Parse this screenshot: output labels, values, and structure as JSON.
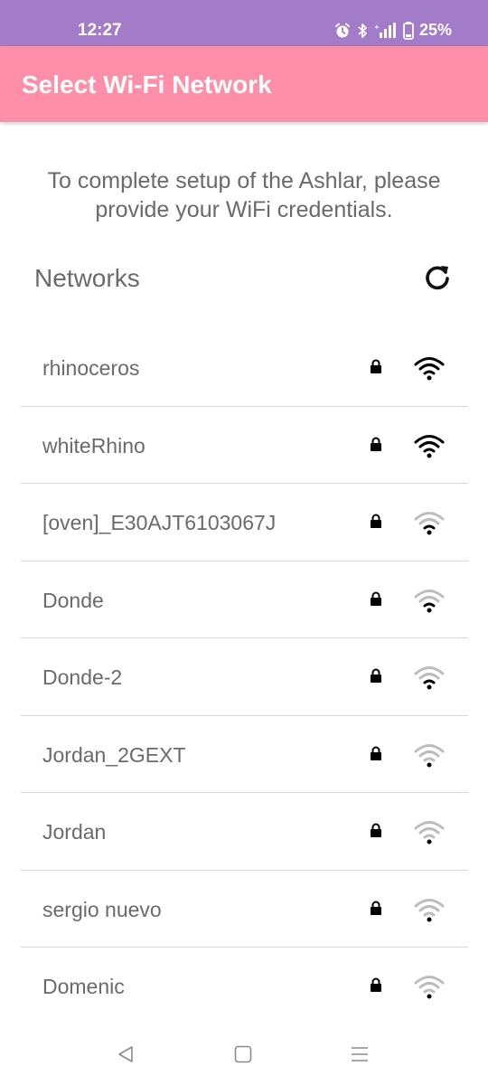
{
  "status_bar": {
    "time": "12:27",
    "battery": "25%",
    "icons": [
      "alarm-icon",
      "bluetooth-icon",
      "signal-icon",
      "battery-icon"
    ],
    "background": "#a27bc9"
  },
  "app_bar": {
    "title": "Select Wi-Fi Network",
    "background": "#ff8fa8"
  },
  "intro": {
    "line1": "To complete setup of the Ashlar, please",
    "line2": "provide your WiFi credentials."
  },
  "networks": {
    "heading": "Networks",
    "refresh_icon": "refresh-icon",
    "items": [
      {
        "ssid": "rhinoceros",
        "secured": true,
        "signal_bars": 3
      },
      {
        "ssid": "whiteRhino",
        "secured": true,
        "signal_bars": 3
      },
      {
        "ssid": "[oven]_E30AJT6103067J",
        "secured": true,
        "signal_bars": 1
      },
      {
        "ssid": "Donde",
        "secured": true,
        "signal_bars": 1
      },
      {
        "ssid": "Donde-2",
        "secured": true,
        "signal_bars": 1
      },
      {
        "ssid": "Jordan_2GEXT",
        "secured": true,
        "signal_bars": 0
      },
      {
        "ssid": "Jordan",
        "secured": true,
        "signal_bars": 0
      },
      {
        "ssid": "sergio nuevo",
        "secured": true,
        "signal_bars": 0
      },
      {
        "ssid": "Domenic",
        "secured": true,
        "signal_bars": 0
      }
    ]
  },
  "nav_bar": {
    "icons": [
      "back-icon",
      "home-icon",
      "recents-icon"
    ]
  }
}
